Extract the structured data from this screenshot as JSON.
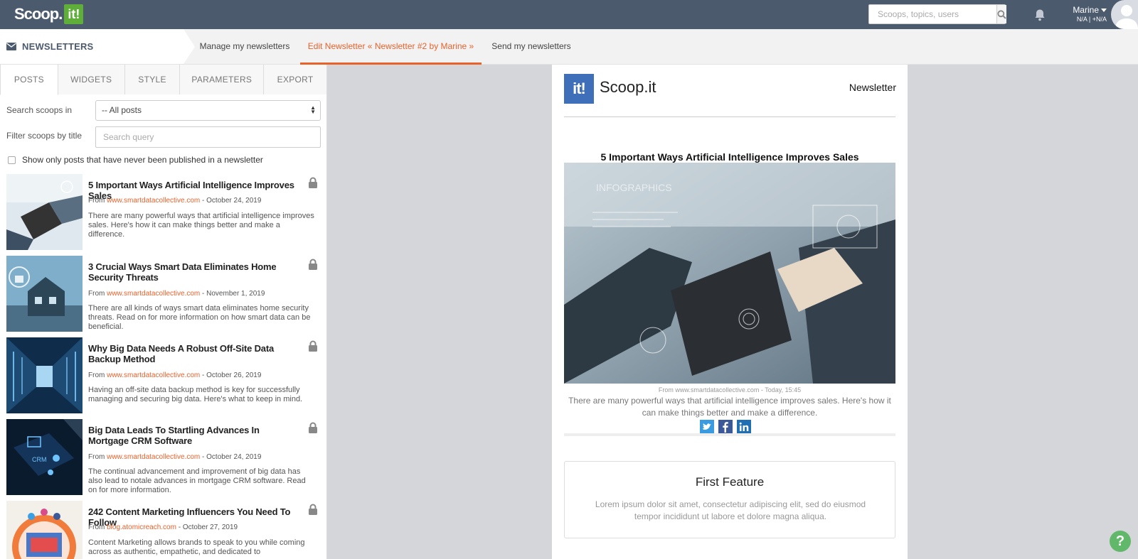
{
  "topbar": {
    "logo_text": "Scoop.",
    "logo_it": "it!",
    "search_placeholder": "Scoops, topics, users",
    "user_name": "Marine",
    "user_sub": "N/A | +N/A"
  },
  "subnav": {
    "section_title": "NEWSLETTERS",
    "tabs": [
      {
        "label": "Manage my newsletters"
      },
      {
        "label": "Edit Newsletter « Newsletter #2 by Marine »"
      },
      {
        "label": "Send my newsletters"
      }
    ]
  },
  "panel": {
    "tabs": [
      {
        "label": "POSTS"
      },
      {
        "label": "WIDGETS"
      },
      {
        "label": "STYLE"
      },
      {
        "label": "PARAMETERS"
      },
      {
        "label": "EXPORT"
      }
    ],
    "search_in_label": "Search scoops in",
    "search_in_value": "-- All posts",
    "filter_label": "Filter scoops by title",
    "filter_placeholder": "Search query",
    "checkbox_label": "Show only posts that have never been published in a newsletter",
    "posts": [
      {
        "title": "5 Important Ways Artificial Intelligence Improves Sales",
        "from": "From ",
        "source": "www.smartdatacollective.com",
        "date": " - October 24, 2019",
        "desc": "There are many powerful ways that artificial intelligence improves sales. Here's how it can make things better and make a difference."
      },
      {
        "title": "3 Crucial Ways Smart Data Eliminates Home Security Threats",
        "from": "From ",
        "source": "www.smartdatacollective.com",
        "date": " - November 1, 2019",
        "desc": "There are all kinds of ways smart data eliminates home security threats. Read on for more information on how smart data can be beneficial."
      },
      {
        "title": "Why Big Data Needs A Robust Off-Site Data Backup Method",
        "from": "From ",
        "source": "www.smartdatacollective.com",
        "date": " - October 26, 2019",
        "desc": "Having an off-site data backup method is key for successfully managing and securing big data. Here's what to keep in mind."
      },
      {
        "title": "Big Data Leads To Startling Advances In Mortgage CRM Software",
        "from": "From ",
        "source": "www.smartdatacollective.com",
        "date": " - October 24, 2019",
        "desc": "The continual advancement and improvement of big data has also lead to notale advances in mortgage CRM software. Read on for more information."
      },
      {
        "title": "242 Content Marketing Influencers You Need To Follow",
        "from": "From ",
        "source": "blog.atomicreach.com",
        "date": " - October 27, 2019",
        "desc": "Content Marketing allows brands to speak to you while coming across as authentic, empathetic, and dedicated to"
      }
    ]
  },
  "preview": {
    "logo": "it!",
    "brand": "Scoop.it",
    "newsletter_label": "Newsletter",
    "article_title": "5 Important Ways Artificial Intelligence Improves Sales",
    "article_from": "From www.smartdatacollective.com - Today, 15:45",
    "article_desc": "There are many powerful ways that artificial intelligence improves sales. Here's how it can make things better and make a difference.",
    "image_overlay": "INFOGRAPHICS",
    "feature_title": "First Feature",
    "feature_text": "Lorem ipsum dolor sit amet, consectetur adipiscing elit, sed do eiusmod tempor incididunt ut labore et dolore magna aliqua."
  },
  "help_label": "?",
  "colors": {
    "topbar": "#4c5a6e",
    "accent": "#e8622c",
    "brand_green": "#5fae3a",
    "preview_blue": "#3e6fb8"
  }
}
